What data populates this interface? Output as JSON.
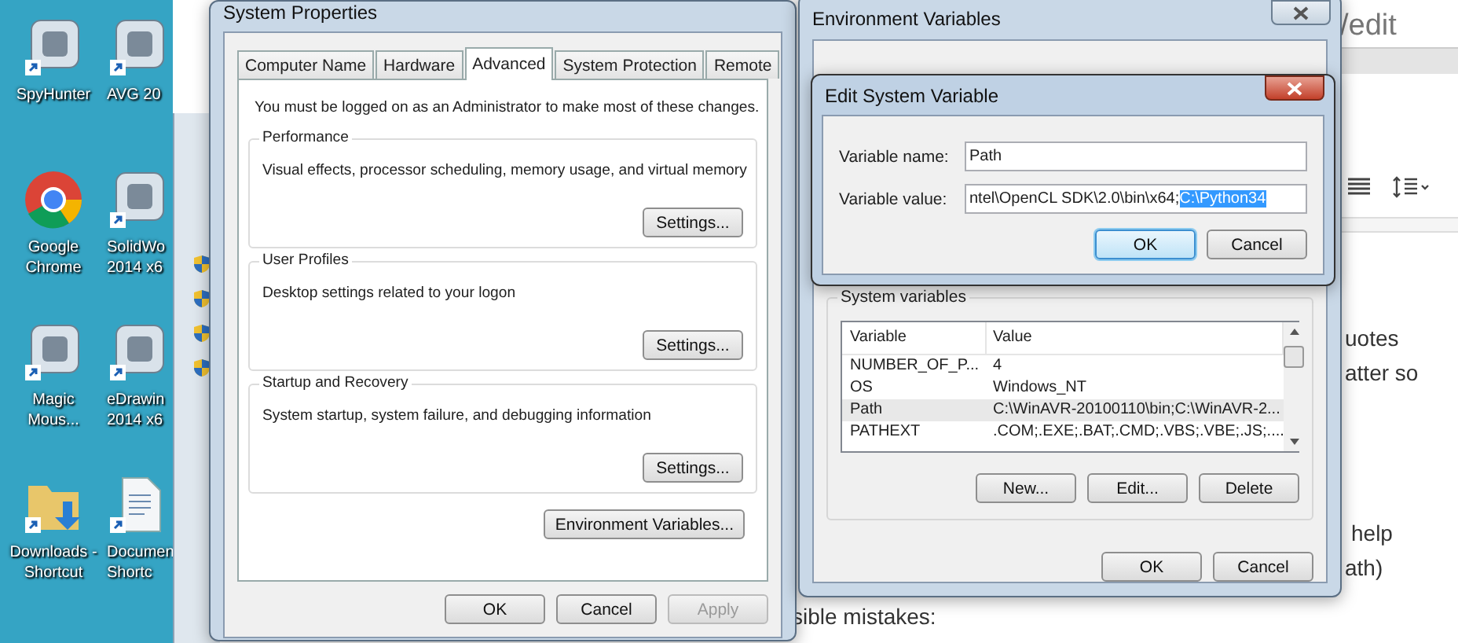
{
  "desktop": {
    "icons": [
      {
        "kind": "app",
        "lines": [
          "SpyHunter"
        ]
      },
      {
        "kind": "app",
        "lines": [
          "AVG 20"
        ]
      },
      {
        "kind": "browser",
        "lines": [
          "Google",
          "Chrome"
        ]
      },
      {
        "kind": "app",
        "lines": [
          "SolidWo",
          "2014 x6"
        ]
      },
      {
        "kind": "app",
        "lines": [
          "Magic",
          "Mous..."
        ]
      },
      {
        "kind": "app",
        "lines": [
          "eDrawin",
          "2014 x6"
        ]
      },
      {
        "kind": "folder",
        "lines": [
          "Downloads -",
          "Shortcut"
        ]
      },
      {
        "kind": "document",
        "lines": [
          "Documen",
          "Shortc"
        ]
      }
    ]
  },
  "document": {
    "address_fragment": "/edit",
    "text_fragments": [
      "uotes",
      "atter so",
      "help",
      "ath)"
    ],
    "bottom_fragment": "sible mistakes:"
  },
  "system_properties": {
    "title": "System Properties",
    "tabs": [
      {
        "label": "Computer Name",
        "selected": false
      },
      {
        "label": "Hardware",
        "selected": false
      },
      {
        "label": "Advanced",
        "selected": true
      },
      {
        "label": "System Protection",
        "selected": false
      },
      {
        "label": "Remote",
        "selected": false
      }
    ],
    "notice": "You must be logged on as an Administrator to make most of these changes.",
    "groups": [
      {
        "title": "Performance",
        "description": "Visual effects, processor scheduling, memory usage, and virtual memory",
        "button": "Settings..."
      },
      {
        "title": "User Profiles",
        "description": "Desktop settings related to your logon",
        "button": "Settings..."
      },
      {
        "title": "Startup and Recovery",
        "description": "System startup, system failure, and debugging information",
        "button": "Settings..."
      }
    ],
    "env_button": "Environment Variables...",
    "buttons": [
      {
        "label": "OK",
        "disabled": false
      },
      {
        "label": "Cancel",
        "disabled": false
      },
      {
        "label": "Apply",
        "disabled": true
      }
    ]
  },
  "environment_variables": {
    "title": "Environment Variables",
    "group_title": "System variables",
    "columns": [
      "Variable",
      "Value"
    ],
    "rows": [
      {
        "variable": "NUMBER_OF_P...",
        "value": "4",
        "selected": false
      },
      {
        "variable": "OS",
        "value": "Windows_NT",
        "selected": false
      },
      {
        "variable": "Path",
        "value": "C:\\WinAVR-20100110\\bin;C:\\WinAVR-2...",
        "selected": true
      },
      {
        "variable": "PATHEXT",
        "value": ".COM;.EXE;.BAT;.CMD;.VBS;.VBE;.JS;....",
        "selected": false
      }
    ],
    "row_buttons": [
      "New...",
      "Edit...",
      "Delete"
    ],
    "buttons": [
      "OK",
      "Cancel"
    ]
  },
  "edit_dialog": {
    "title": "Edit System Variable",
    "name_label": "Variable name:",
    "name_value": "Path",
    "value_label": "Variable value:",
    "value_text": "ntel\\OpenCL SDK\\2.0\\bin\\x64;",
    "value_selected": "C:\\Python34",
    "buttons": [
      "OK",
      "Cancel"
    ]
  }
}
